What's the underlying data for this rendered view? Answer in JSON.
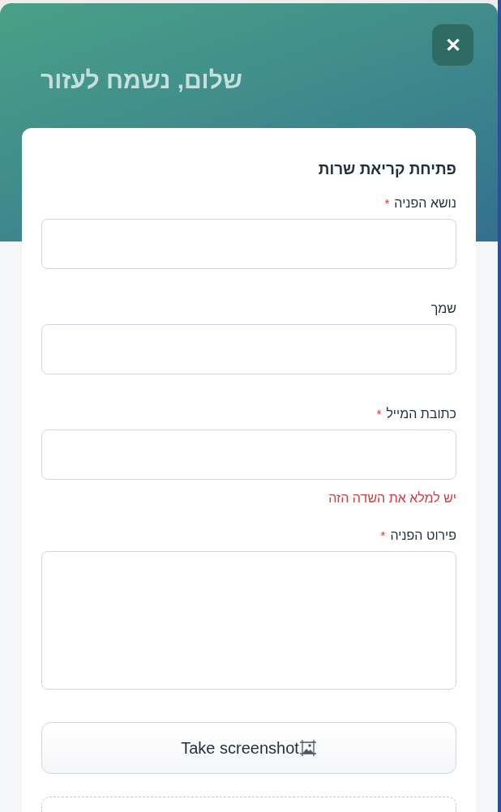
{
  "header": {
    "title": "שלום, נשמח לעזור",
    "close_label": "✕"
  },
  "form": {
    "title": "פתיחת קריאת שרות",
    "fields": [
      {
        "kind": "input",
        "label": "נושא הפניה",
        "required_mark": "*"
      },
      {
        "kind": "input",
        "label": "שמך"
      },
      {
        "kind": "input",
        "label": "כתובת המייל",
        "required_mark": "*",
        "error": "יש למלא את השדה הזה"
      },
      {
        "kind": "textarea",
        "label": "פירוט הפניה",
        "required_mark": "*"
      }
    ],
    "screenshot_button": "Take screenshot"
  }
}
